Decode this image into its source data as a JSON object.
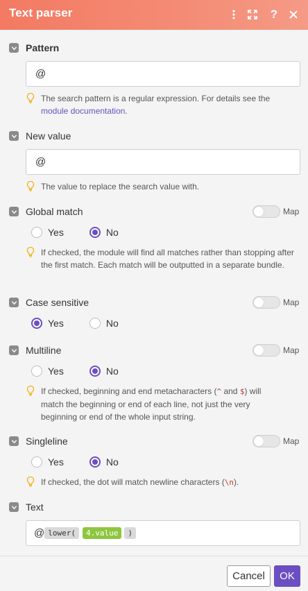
{
  "header": {
    "title": "Text parser",
    "bg_color": "#f48a73",
    "icons": [
      "more-vertical-icon",
      "fullscreen-icon",
      "help-icon",
      "close-icon"
    ]
  },
  "pattern": {
    "label": "Pattern",
    "value": "@",
    "hint": "The search pattern is a regular expression. For details see the",
    "hint_link": "module documentation",
    "hint_end": "."
  },
  "new_value": {
    "label": "New value",
    "value": "@",
    "hint": "The value to replace the search value with."
  },
  "map_label": "Map",
  "options": {
    "yes": "Yes",
    "no": "No"
  },
  "global_match": {
    "label": "Global match",
    "selected": "No",
    "map_enabled": false,
    "hint": "If checked, the module will find all matches rather than stopping after the first match. Each match will be outputted in a separate bundle."
  },
  "case_sensitive": {
    "label": "Case sensitive",
    "selected": "Yes",
    "map_enabled": false
  },
  "multiline": {
    "label": "Multiline",
    "selected": "No",
    "map_enabled": false,
    "hint_a": "If checked, beginning and end metacharacters (",
    "hint_code1": "^",
    "hint_b": " and ",
    "hint_code2": "$",
    "hint_c": ") will match the beginning or end of each line, not just the very beginning or end of the whole input string."
  },
  "singleline": {
    "label": "Singleline",
    "selected": "No",
    "map_enabled": false,
    "hint_a": "If checked, the dot will match newline characters (",
    "hint_code": "\\n",
    "hint_b": ")."
  },
  "text": {
    "label": "Text",
    "prefix": "@",
    "fn": "lower(",
    "var": "4.value",
    "close": ")"
  },
  "footer": {
    "cancel": "Cancel",
    "ok": "OK",
    "accent": "#6b4ec2"
  }
}
